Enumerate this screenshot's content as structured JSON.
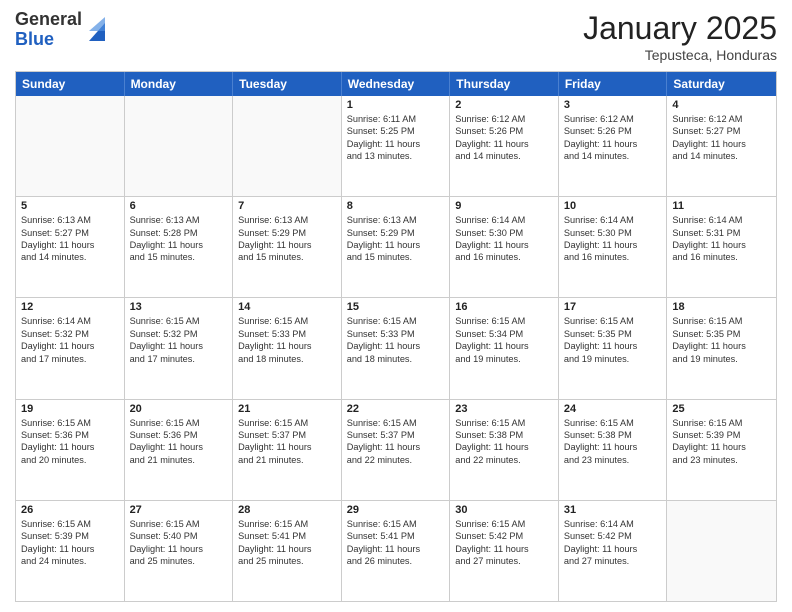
{
  "logo": {
    "general": "General",
    "blue": "Blue"
  },
  "header": {
    "month": "January 2025",
    "location": "Tepusteca, Honduras"
  },
  "weekdays": [
    "Sunday",
    "Monday",
    "Tuesday",
    "Wednesday",
    "Thursday",
    "Friday",
    "Saturday"
  ],
  "rows": [
    [
      {
        "day": "",
        "info": [],
        "empty": true
      },
      {
        "day": "",
        "info": [],
        "empty": true
      },
      {
        "day": "",
        "info": [],
        "empty": true
      },
      {
        "day": "1",
        "info": [
          "Sunrise: 6:11 AM",
          "Sunset: 5:25 PM",
          "Daylight: 11 hours",
          "and 13 minutes."
        ],
        "empty": false
      },
      {
        "day": "2",
        "info": [
          "Sunrise: 6:12 AM",
          "Sunset: 5:26 PM",
          "Daylight: 11 hours",
          "and 14 minutes."
        ],
        "empty": false
      },
      {
        "day": "3",
        "info": [
          "Sunrise: 6:12 AM",
          "Sunset: 5:26 PM",
          "Daylight: 11 hours",
          "and 14 minutes."
        ],
        "empty": false
      },
      {
        "day": "4",
        "info": [
          "Sunrise: 6:12 AM",
          "Sunset: 5:27 PM",
          "Daylight: 11 hours",
          "and 14 minutes."
        ],
        "empty": false
      }
    ],
    [
      {
        "day": "5",
        "info": [
          "Sunrise: 6:13 AM",
          "Sunset: 5:27 PM",
          "Daylight: 11 hours",
          "and 14 minutes."
        ],
        "empty": false
      },
      {
        "day": "6",
        "info": [
          "Sunrise: 6:13 AM",
          "Sunset: 5:28 PM",
          "Daylight: 11 hours",
          "and 15 minutes."
        ],
        "empty": false
      },
      {
        "day": "7",
        "info": [
          "Sunrise: 6:13 AM",
          "Sunset: 5:29 PM",
          "Daylight: 11 hours",
          "and 15 minutes."
        ],
        "empty": false
      },
      {
        "day": "8",
        "info": [
          "Sunrise: 6:13 AM",
          "Sunset: 5:29 PM",
          "Daylight: 11 hours",
          "and 15 minutes."
        ],
        "empty": false
      },
      {
        "day": "9",
        "info": [
          "Sunrise: 6:14 AM",
          "Sunset: 5:30 PM",
          "Daylight: 11 hours",
          "and 16 minutes."
        ],
        "empty": false
      },
      {
        "day": "10",
        "info": [
          "Sunrise: 6:14 AM",
          "Sunset: 5:30 PM",
          "Daylight: 11 hours",
          "and 16 minutes."
        ],
        "empty": false
      },
      {
        "day": "11",
        "info": [
          "Sunrise: 6:14 AM",
          "Sunset: 5:31 PM",
          "Daylight: 11 hours",
          "and 16 minutes."
        ],
        "empty": false
      }
    ],
    [
      {
        "day": "12",
        "info": [
          "Sunrise: 6:14 AM",
          "Sunset: 5:32 PM",
          "Daylight: 11 hours",
          "and 17 minutes."
        ],
        "empty": false
      },
      {
        "day": "13",
        "info": [
          "Sunrise: 6:15 AM",
          "Sunset: 5:32 PM",
          "Daylight: 11 hours",
          "and 17 minutes."
        ],
        "empty": false
      },
      {
        "day": "14",
        "info": [
          "Sunrise: 6:15 AM",
          "Sunset: 5:33 PM",
          "Daylight: 11 hours",
          "and 18 minutes."
        ],
        "empty": false
      },
      {
        "day": "15",
        "info": [
          "Sunrise: 6:15 AM",
          "Sunset: 5:33 PM",
          "Daylight: 11 hours",
          "and 18 minutes."
        ],
        "empty": false
      },
      {
        "day": "16",
        "info": [
          "Sunrise: 6:15 AM",
          "Sunset: 5:34 PM",
          "Daylight: 11 hours",
          "and 19 minutes."
        ],
        "empty": false
      },
      {
        "day": "17",
        "info": [
          "Sunrise: 6:15 AM",
          "Sunset: 5:35 PM",
          "Daylight: 11 hours",
          "and 19 minutes."
        ],
        "empty": false
      },
      {
        "day": "18",
        "info": [
          "Sunrise: 6:15 AM",
          "Sunset: 5:35 PM",
          "Daylight: 11 hours",
          "and 19 minutes."
        ],
        "empty": false
      }
    ],
    [
      {
        "day": "19",
        "info": [
          "Sunrise: 6:15 AM",
          "Sunset: 5:36 PM",
          "Daylight: 11 hours",
          "and 20 minutes."
        ],
        "empty": false
      },
      {
        "day": "20",
        "info": [
          "Sunrise: 6:15 AM",
          "Sunset: 5:36 PM",
          "Daylight: 11 hours",
          "and 21 minutes."
        ],
        "empty": false
      },
      {
        "day": "21",
        "info": [
          "Sunrise: 6:15 AM",
          "Sunset: 5:37 PM",
          "Daylight: 11 hours",
          "and 21 minutes."
        ],
        "empty": false
      },
      {
        "day": "22",
        "info": [
          "Sunrise: 6:15 AM",
          "Sunset: 5:37 PM",
          "Daylight: 11 hours",
          "and 22 minutes."
        ],
        "empty": false
      },
      {
        "day": "23",
        "info": [
          "Sunrise: 6:15 AM",
          "Sunset: 5:38 PM",
          "Daylight: 11 hours",
          "and 22 minutes."
        ],
        "empty": false
      },
      {
        "day": "24",
        "info": [
          "Sunrise: 6:15 AM",
          "Sunset: 5:38 PM",
          "Daylight: 11 hours",
          "and 23 minutes."
        ],
        "empty": false
      },
      {
        "day": "25",
        "info": [
          "Sunrise: 6:15 AM",
          "Sunset: 5:39 PM",
          "Daylight: 11 hours",
          "and 23 minutes."
        ],
        "empty": false
      }
    ],
    [
      {
        "day": "26",
        "info": [
          "Sunrise: 6:15 AM",
          "Sunset: 5:39 PM",
          "Daylight: 11 hours",
          "and 24 minutes."
        ],
        "empty": false
      },
      {
        "day": "27",
        "info": [
          "Sunrise: 6:15 AM",
          "Sunset: 5:40 PM",
          "Daylight: 11 hours",
          "and 25 minutes."
        ],
        "empty": false
      },
      {
        "day": "28",
        "info": [
          "Sunrise: 6:15 AM",
          "Sunset: 5:41 PM",
          "Daylight: 11 hours",
          "and 25 minutes."
        ],
        "empty": false
      },
      {
        "day": "29",
        "info": [
          "Sunrise: 6:15 AM",
          "Sunset: 5:41 PM",
          "Daylight: 11 hours",
          "and 26 minutes."
        ],
        "empty": false
      },
      {
        "day": "30",
        "info": [
          "Sunrise: 6:15 AM",
          "Sunset: 5:42 PM",
          "Daylight: 11 hours",
          "and 27 minutes."
        ],
        "empty": false
      },
      {
        "day": "31",
        "info": [
          "Sunrise: 6:14 AM",
          "Sunset: 5:42 PM",
          "Daylight: 11 hours",
          "and 27 minutes."
        ],
        "empty": false
      },
      {
        "day": "",
        "info": [],
        "empty": true
      }
    ]
  ]
}
